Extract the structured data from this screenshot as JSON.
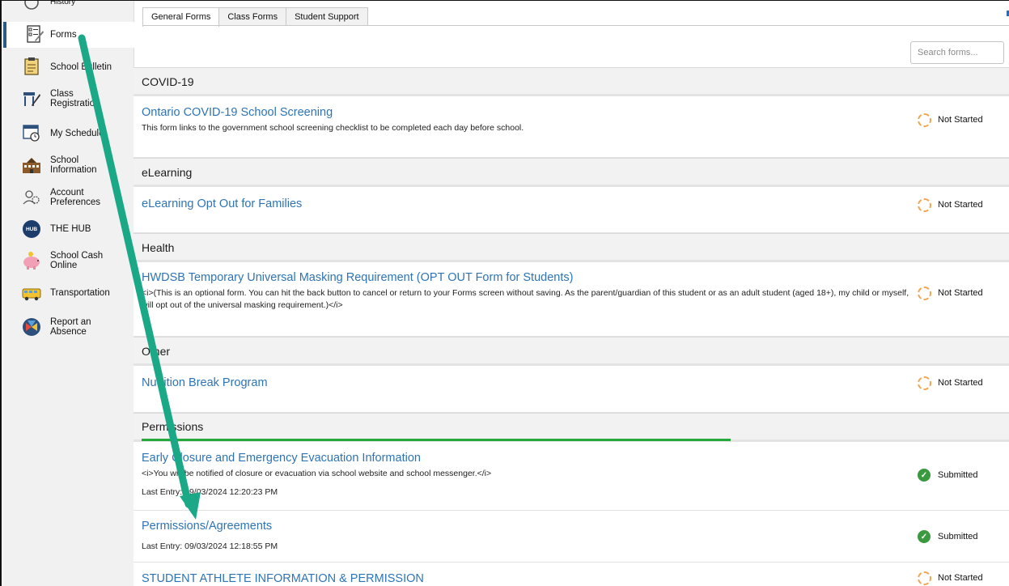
{
  "sidebar": {
    "items": [
      {
        "label": "History",
        "icon": "history-icon"
      },
      {
        "label": "Forms",
        "icon": "forms-icon"
      },
      {
        "label": "School Bulletin",
        "icon": "bulletin-icon"
      },
      {
        "label": "Class\nRegistration",
        "icon": "registration-icon"
      },
      {
        "label": "My Schedule",
        "icon": "calendar-icon"
      },
      {
        "label": "School\nInformation",
        "icon": "school-icon"
      },
      {
        "label": "Account\nPreferences",
        "icon": "account-preferences-icon"
      },
      {
        "label": "THE HUB",
        "icon": "hub-icon",
        "badge": "HUB"
      },
      {
        "label": "School Cash\nOnline",
        "icon": "piggy-bank-icon"
      },
      {
        "label": "Transportation",
        "icon": "bus-icon"
      },
      {
        "label": "Report an\nAbsence",
        "icon": "report-absence-icon"
      }
    ]
  },
  "tabs": [
    "General Forms",
    "Class Forms",
    "Student Support"
  ],
  "search": {
    "placeholder": "Search forms..."
  },
  "sections": [
    {
      "title": "COVID-19"
    },
    {
      "title": "eLearning"
    },
    {
      "title": "Health"
    },
    {
      "title": "Other"
    },
    {
      "title": "Permissions"
    }
  ],
  "forms": [
    {
      "title": "Ontario COVID-19 School Screening",
      "desc": "This form links to the government school screening checklist to be completed each day before school.",
      "status": "Not Started"
    },
    {
      "title": "eLearning Opt Out for Families",
      "status": "Not Started"
    },
    {
      "title": "HWDSB Temporary Universal Masking Requirement (OPT OUT Form for Students)",
      "desc": "<i>(This is an optional form. You can hit the back button to cancel or return to your Forms screen without saving. As the parent/guardian of this student or as an adult student (aged 18+), my child or myself, will opt out of the universal masking requirement.)</i>",
      "status": "Not Started"
    },
    {
      "title": "Nutrition Break Program",
      "status": "Not Started"
    },
    {
      "title": "Early Closure and Emergency Evacuation Information",
      "desc": "<i>You will be notified of closure or evacuation via school website and school messenger.</i>",
      "entry": "Last Entry: 09/03/2024 12:20:23 PM",
      "status": "Submitted"
    },
    {
      "title": "Permissions/Agreements",
      "entry": "Last Entry: 09/03/2024 12:18:55 PM",
      "status": "Submitted"
    },
    {
      "title": "STUDENT ATHLETE INFORMATION & PERMISSION",
      "status": "Not Started"
    }
  ],
  "colors": {
    "link": "#2e74b5",
    "progress": "#25a83a",
    "annotation_arrow": "#1aa886",
    "not_started": "#f2a450",
    "submitted": "#3b9a3f"
  }
}
